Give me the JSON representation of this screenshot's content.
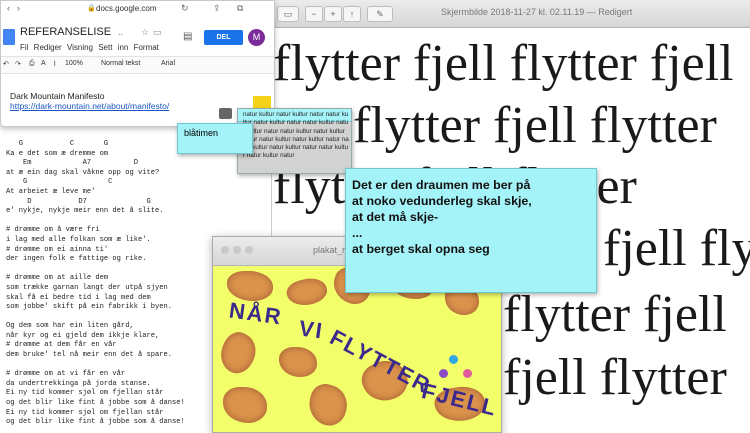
{
  "preview": {
    "title": "Skjermbilde 2018-11-27 kl. 02.11.19 — Redigert",
    "lines": [
      "flytter fjell flytter fjell",
      "flytter fjell flytter",
      "flytter fjell flytter",
      "fjell flytter",
      "flytter fjell",
      "fjell flytter"
    ]
  },
  "gdocs": {
    "url": "docs.google.com",
    "doc_title": "REFERANSELISE",
    "menu": "Fil Rediger Visning Sett inn Format",
    "share_label": "DEL",
    "avatar": "M",
    "toolbar": {
      "zoom": "100%",
      "style": "Normal tekst",
      "font": "Arial"
    },
    "body_title": "Dark Mountain Manifesto",
    "body_link": "https://dark-mountain.net/about/manifesto/"
  },
  "music_text": "   G           C       G\nKa e det som æ dremme om\n    Em            A7          D\nat æ ein dag skal våkne opp og vite?\n    G                   C\nAt arbeiet æ leve me'\n     D           D7              G\ne' nykje, nykje meir enn det å slite.\n\n# drømme om å være fri\ni lag med alle folkan som æ like'.\n# drømme om ei ainna ti'\nder ingen folk e fattige og rike.\n\n# drømme om at aille dem\nsom trække garnan langt der utpå sjyen\nskal få ei bedre tid i lag med dem\nsom jobbe' skift på ein fabrikk i byen.\n\nOg dem som har ein liten gård,\nnår kyr og ei gjeld dem ikkje klare,\n# drømme at dem får en vår\ndem bruke' tel nå meir enn det å spare.\n\n# drømme om at vi får en vår\nda undertrekkinga på jorda stanse.\nEi ny tid kommer sjøl om fjellan står\nog det blir like fint å jobbe som å danse!\nEi ny tid kommer sjøl om fjellan står\nog det blir like fint å jobbe som å danse!",
  "sticky_bla": "blåtimen",
  "sticky_natur": "natur kultur natur kultur natur natur kultur natur kultur natur natur kultur natur kultur natur natur kultur natur kultur natur natur kultur natur kultur natur natur kultur natur kultur natur natur kultur natur kultur natur",
  "sticky_main": [
    "Det er den draumen me ber på",
    "at noko vedunderleg skal skje,",
    "at det må skje-",
    "...",
    "at berget skal opna seg"
  ],
  "plakat": {
    "title": "plakat_ny",
    "words": [
      "NÅR",
      "VI",
      "FLYTTER",
      "FJELL"
    ]
  }
}
